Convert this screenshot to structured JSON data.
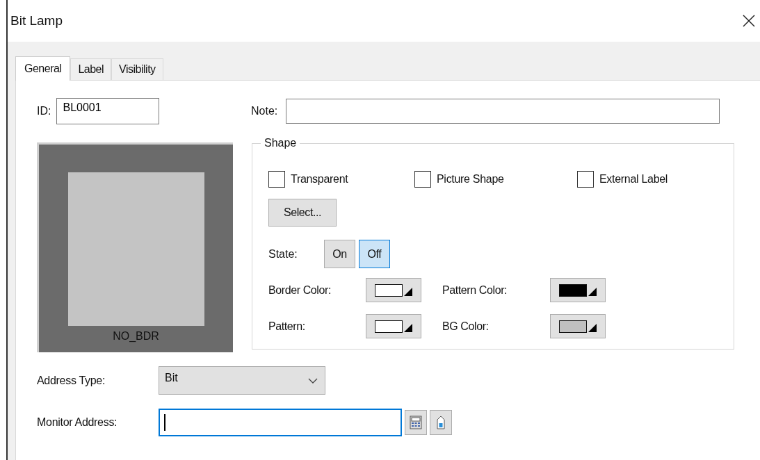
{
  "window": {
    "title": "Bit Lamp"
  },
  "tabs": [
    {
      "label": "General",
      "selected": true
    },
    {
      "label": "Label",
      "selected": false
    },
    {
      "label": "Visibility",
      "selected": false
    }
  ],
  "id_field": {
    "label": "ID:",
    "value": "BL0001"
  },
  "note_field": {
    "label": "Note:"
  },
  "preview": {
    "caption": "NO_BDR"
  },
  "shape": {
    "title": "Shape",
    "checkboxes": [
      {
        "label": "Transparent",
        "checked": false
      },
      {
        "label": "Picture Shape",
        "checked": false
      },
      {
        "label": "External Label",
        "checked": false
      }
    ],
    "select_button": "Select...",
    "state": {
      "label": "State:",
      "options": [
        {
          "label": "On",
          "selected": false
        },
        {
          "label": "Off",
          "selected": true
        }
      ]
    },
    "colors": [
      {
        "label": "Border Color:",
        "color": "#ffffff"
      },
      {
        "label": "Pattern Color:",
        "color": "#000000"
      },
      {
        "label": "Pattern:",
        "color": "#ffffff"
      },
      {
        "label": "BG Color:",
        "color": "#c0c0c0"
      }
    ]
  },
  "address_type": {
    "label": "Address Type:",
    "value": "Bit"
  },
  "monitor_address": {
    "label": "Monitor Address:",
    "focused": true
  }
}
